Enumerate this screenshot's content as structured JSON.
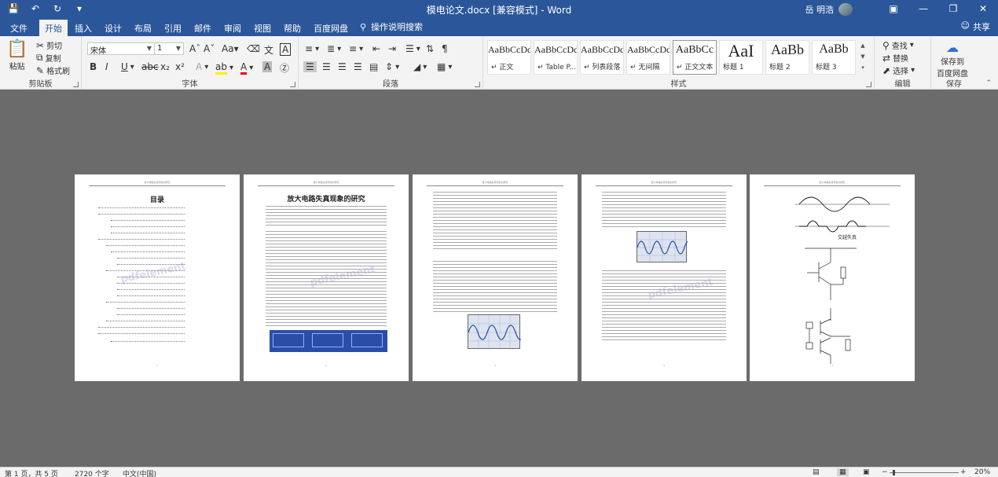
{
  "titlebar": {
    "title": "模电论文.docx [兼容模式] - Word",
    "user": "岳 明浩",
    "qat": {
      "save_icon": "save-icon",
      "undo_icon": "undo-icon",
      "redo_icon": "redo-icon",
      "customize_icon": "customize-icon"
    }
  },
  "tabs": [
    "文件",
    "开始",
    "插入",
    "设计",
    "布局",
    "引用",
    "邮件",
    "审阅",
    "视图",
    "帮助",
    "百度网盘"
  ],
  "active_tab": "开始",
  "tellme": "操作说明搜索",
  "share": "共享",
  "ribbon": {
    "clipboard": {
      "label": "剪贴板",
      "paste": "粘贴",
      "cut": "剪切",
      "copy": "复制",
      "format_painter": "格式刷"
    },
    "font": {
      "label": "字体",
      "font_name": "宋体",
      "font_size": "1"
    },
    "paragraph": {
      "label": "段落"
    },
    "styles": {
      "label": "样式",
      "items": [
        {
          "preview": "AaBbCcDdI",
          "name": "↵ 正文"
        },
        {
          "preview": "AaBbCcDdI",
          "name": "↵ Table P..."
        },
        {
          "preview": "AaBbCcDdI",
          "name": "↵ 列表段落"
        },
        {
          "preview": "AaBbCcDdI",
          "name": "↵ 无间隔"
        },
        {
          "preview": "AaBbCc",
          "name": "↵ 正文文本"
        },
        {
          "preview": "AaI",
          "name": "标题 1"
        },
        {
          "preview": "AaBb",
          "name": "标题 2"
        },
        {
          "preview": "AaBb",
          "name": "标题 3"
        }
      ]
    },
    "editing": {
      "label": "编辑",
      "find": "查找",
      "replace": "替换",
      "select": "选择"
    },
    "save": {
      "label": "保存",
      "button_line1": "保存到",
      "button_line2": "百度网盘"
    }
  },
  "document": {
    "toc_title": "目录",
    "paper_title": "放大电路失真现象的研究",
    "watermark": "pdfelement",
    "wave_caption": "交越失真",
    "header_text": "放大电路失真现象的研究"
  },
  "status": {
    "page": "第 1 页，共 5 页",
    "words": "2720 个字",
    "language": "中文(中国)",
    "zoom": "20%",
    "zoom_level": 0.2
  },
  "colors": {
    "titlebar": "#2b579a",
    "ribbon": "#f3f3f3",
    "canvas": "#6b6b6b",
    "figure_blue": "#2a4ea8"
  }
}
